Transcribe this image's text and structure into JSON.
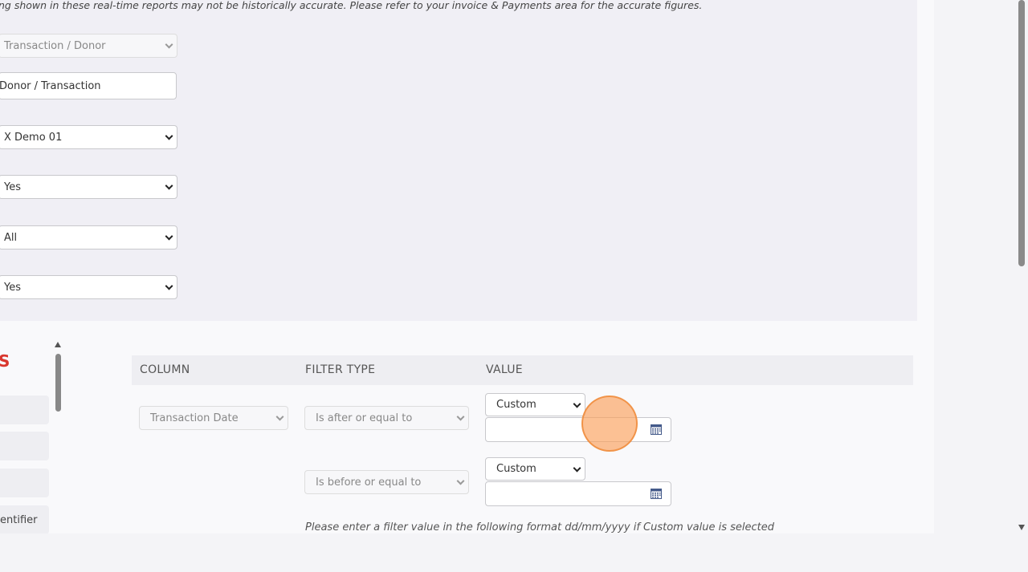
{
  "notice": "ng shown in these real-time reports may not be historically accurate. Please refer to your invoice & Payments area for the accurate figures.",
  "settings": {
    "group_by": "Transaction / Donor",
    "report_level": "Donor / Transaction",
    "campaign": "X Demo 01",
    "option_1": "Yes",
    "option_2": "All",
    "option_3": "Yes"
  },
  "columns_section": {
    "heading_fragment": "S",
    "items": [
      "",
      "",
      "",
      "entifier"
    ]
  },
  "filters": {
    "headers": {
      "column": "COLUMN",
      "filter_type": "FILTER TYPE",
      "value": "VALUE"
    },
    "row1": {
      "column": "Transaction Date",
      "filter_type": "Is after or equal to",
      "value_mode": "Custom",
      "date_value": ""
    },
    "row2": {
      "filter_type": "Is before or equal to",
      "value_mode": "Custom",
      "date_value": ""
    },
    "hint": "Please enter a filter value in the following format dd/mm/yyyy if Custom value is selected"
  },
  "icons": {
    "calendar": "calendar-icon",
    "chevron": "chevron-down-icon"
  },
  "colors": {
    "accent_red": "#d9372e",
    "panel": "#f0eff5",
    "cursor": "#f8a05a"
  }
}
